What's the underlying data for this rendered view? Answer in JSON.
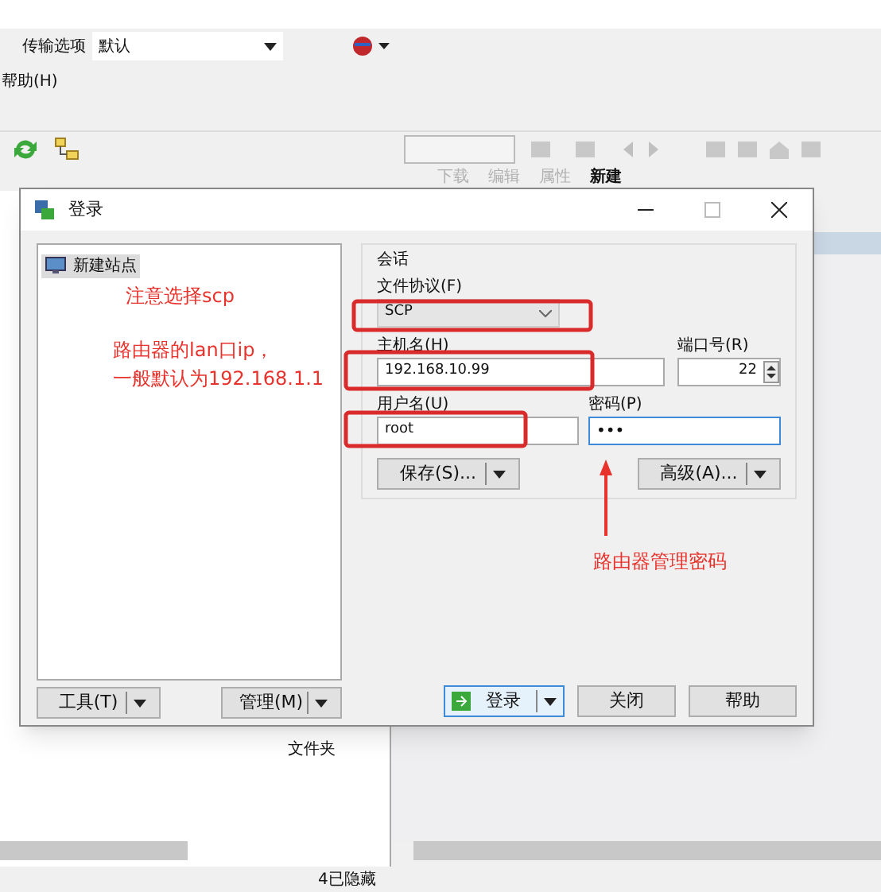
{
  "toolbar": {
    "transfer_label": "传输选项",
    "transfer_value": "默认"
  },
  "menu": [
    "帮助(H)"
  ],
  "toolbar2": [
    {
      "label": "下载",
      "disabled": true
    },
    {
      "label": "编辑",
      "disabled": true
    },
    {
      "label": "属性",
      "disabled": true
    },
    {
      "label": "新建",
      "disabled": false
    }
  ],
  "left_pane": {
    "cell": "文件夹"
  },
  "status_bar": "4已隐藏",
  "dialog": {
    "title": "登录",
    "sites": [
      {
        "label": "新建站点",
        "selected": true
      }
    ],
    "tools_button": "工具(T)",
    "manage_button": "管理(M)",
    "session_label": "会话",
    "protocol_label": "文件协议(F)",
    "protocol_value": "SCP",
    "host_label": "主机名(H)",
    "host_value": "192.168.10.99",
    "port_label": "端口号(R)",
    "port_value": "22",
    "user_label": "用户名(U)",
    "user_value": "root",
    "password_label": "密码(P)",
    "password_value": "•••",
    "save_button": "保存(S)...",
    "advanced_button": "高级(A)...",
    "login_button": "登录",
    "close_button": "关闭",
    "help_button": "帮助"
  },
  "annotations": {
    "protocol_note": "注意选择scp",
    "host_note": [
      "路由器的lan口ip，",
      "一般默认为192.168.1.1"
    ],
    "password_note": "路由器管理密码"
  }
}
